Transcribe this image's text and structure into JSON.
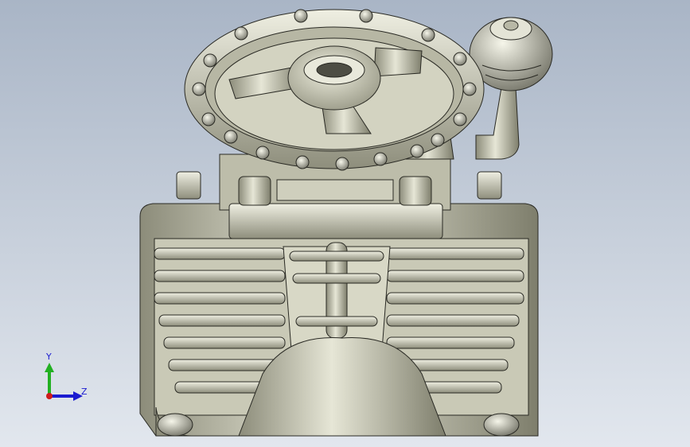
{
  "viewport": {
    "background_top": "#a9b5c6",
    "background_bottom": "#e2e7ee"
  },
  "model": {
    "part_color": "#c8c8b4",
    "edge_color": "#2a2a24"
  },
  "triad": {
    "y_label": "Y",
    "z_label": "Z",
    "y_color": "#22b022",
    "z_color": "#1b1bd0",
    "x_color": "#d01b1b",
    "icon": "view-orientation-triad-icon"
  }
}
